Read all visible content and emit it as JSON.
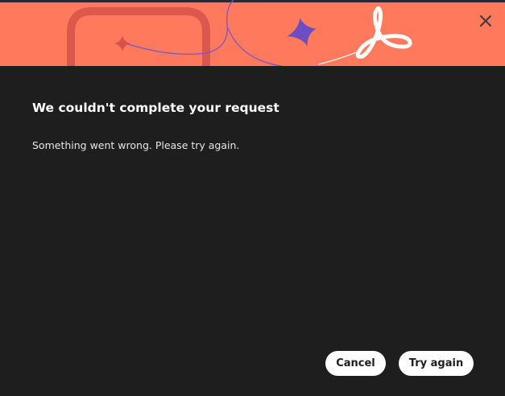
{
  "dialog": {
    "title": "We couldn't complete your request",
    "message": "Something went wrong. Please try again.",
    "cancel_label": "Cancel",
    "try_again_label": "Try again"
  },
  "banner": {
    "background_color": "#ff7a5c",
    "logo": "acrobat-logo-icon",
    "close_icon": "close-icon"
  },
  "colors": {
    "dialog_background": "#1e1e1e",
    "button_background": "#ffffff",
    "accent_purple": "#6b4ec4"
  }
}
